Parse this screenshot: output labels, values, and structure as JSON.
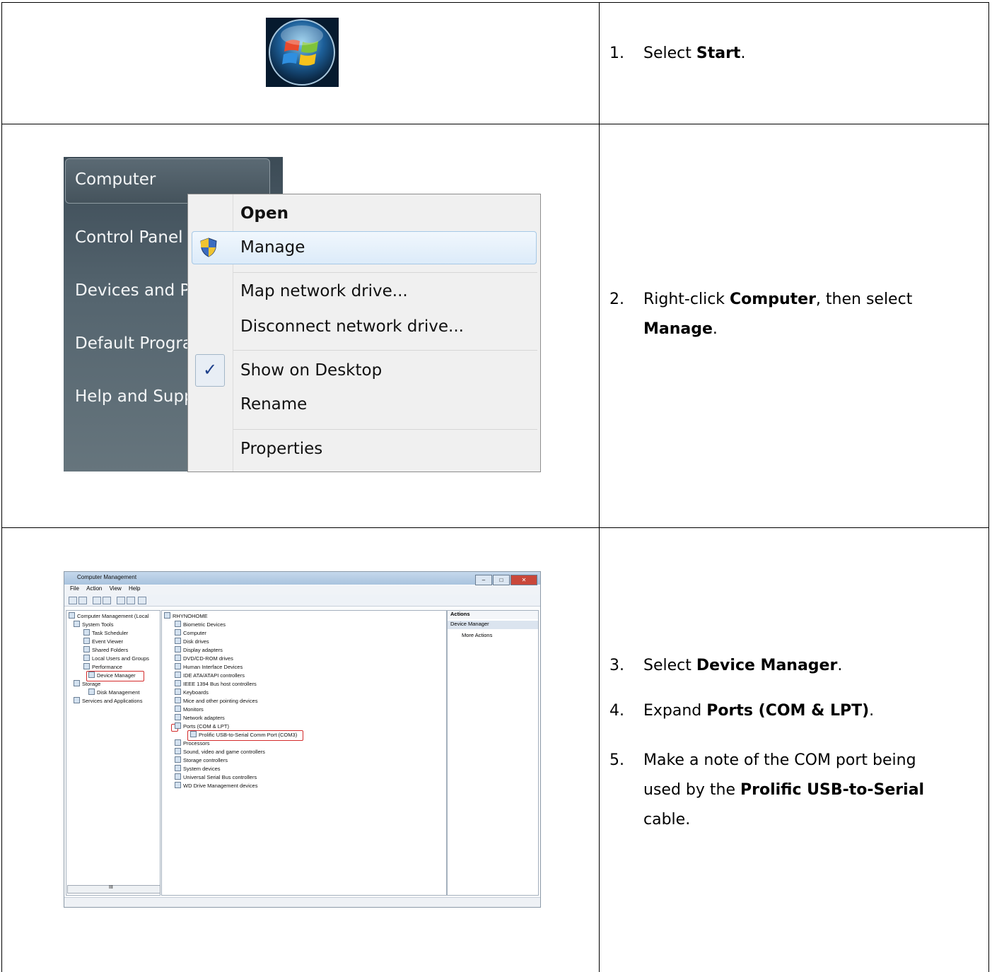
{
  "steps": [
    {
      "num": "1.",
      "pre": "Select ",
      "bold": "Start",
      "post": "."
    },
    {
      "num": "2.",
      "pre": "Right-click ",
      "bold": "Computer",
      "mid": ", then select ",
      "bold2": "Manage",
      "post": "."
    },
    {
      "num": "3.",
      "pre": "Select ",
      "bold": "Device Manager",
      "post": "."
    },
    {
      "num": "4.",
      "pre": "Expand ",
      "bold": "Ports (COM & LPT)",
      "post": "."
    },
    {
      "num": "5.",
      "pre": "Make a note of the COM port being used by the ",
      "bold": "Prolific USB-to-Serial",
      "post": " cable."
    }
  ],
  "start_menu": {
    "items": [
      "Computer",
      "Control Panel",
      "Devices and P",
      "Default Progra",
      "Help and Supp"
    ]
  },
  "context_menu": {
    "items": [
      "Open",
      "Manage",
      "Map network drive...",
      "Disconnect network drive...",
      "Show on Desktop",
      "Rename",
      "Properties"
    ],
    "check_mark": "✓"
  },
  "computer_management": {
    "title": "Computer Management",
    "menu": [
      "File",
      "Action",
      "View",
      "Help"
    ],
    "left_tree": [
      "Computer Management (Local",
      "System Tools",
      "Task Scheduler",
      "Event Viewer",
      "Shared Folders",
      "Local Users and Groups",
      "Performance",
      "Device Manager",
      "Storage",
      "Disk Management",
      "Services and Applications"
    ],
    "device_root": "RHYNOHOME",
    "devices": [
      "Biometric Devices",
      "Computer",
      "Disk drives",
      "Display adapters",
      "DVD/CD-ROM drives",
      "Human Interface Devices",
      "IDE ATA/ATAPI controllers",
      "IEEE 1394 Bus host controllers",
      "Keyboards",
      "Mice and other pointing devices",
      "Monitors",
      "Network adapters",
      "Ports (COM & LPT)",
      "Prolific USB-to-Serial Comm Port (COM3)",
      "Processors",
      "Sound, video and game controllers",
      "Storage controllers",
      "System devices",
      "Universal Serial Bus controllers",
      "WD Drive Management devices"
    ],
    "actions_header": "Actions",
    "actions_selected": "Device Manager",
    "actions_more": "More Actions",
    "scroll_label": "III"
  }
}
